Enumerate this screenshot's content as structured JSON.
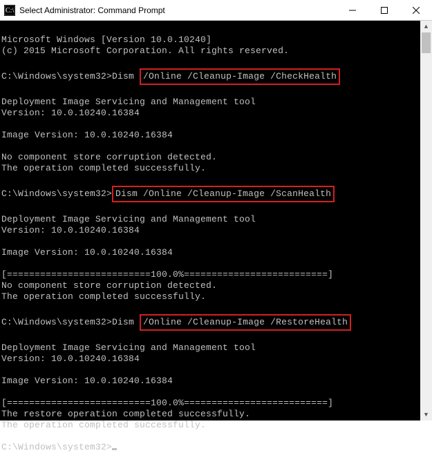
{
  "window": {
    "title": "Select Administrator: Command Prompt"
  },
  "lines": {
    "l0": "Microsoft Windows [Version 10.0.10240]",
    "l1": "(c) 2015 Microsoft Corporation. All rights reserved.",
    "l2": "",
    "prompt1pre": "C:\\Windows\\system32>Dism ",
    "cmd1": "/Online /Cleanup-Image /CheckHealth",
    "l4": "",
    "l5": "Deployment Image Servicing and Management tool",
    "l6": "Version: 10.0.10240.16384",
    "l7": "",
    "l8": "Image Version: 10.0.10240.16384",
    "l9": "",
    "l10": "No component store corruption detected.",
    "l11": "The operation completed successfully.",
    "l12": "",
    "prompt2pre": "C:\\Windows\\system32>",
    "cmd2": "Dism /Online /Cleanup-Image /ScanHealth",
    "l14": "",
    "l15": "Deployment Image Servicing and Management tool",
    "l16": "Version: 10.0.10240.16384",
    "l17": "",
    "l18": "Image Version: 10.0.10240.16384",
    "l19": "",
    "l20": "[==========================100.0%==========================]",
    "l21": "No component store corruption detected.",
    "l22": "The operation completed successfully.",
    "l23": "",
    "prompt3pre": "C:\\Windows\\system32>Dism ",
    "cmd3": "/Online /Cleanup-Image /RestoreHealth",
    "l25": "",
    "l26": "Deployment Image Servicing and Management tool",
    "l27": "Version: 10.0.10240.16384",
    "l28": "",
    "l29": "Image Version: 10.0.10240.16384",
    "l30": "",
    "l31": "[==========================100.0%==========================]",
    "l32": "The restore operation completed successfully.",
    "l33": "The operation completed successfully.",
    "l34": "",
    "prompt4": "C:\\Windows\\system32>"
  }
}
